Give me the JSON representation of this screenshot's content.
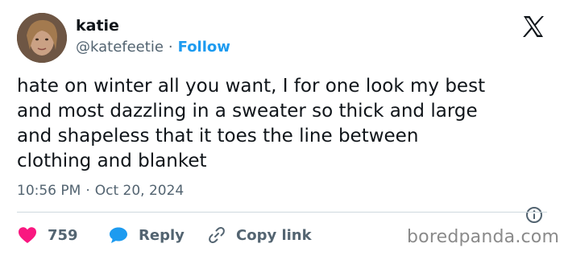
{
  "author": {
    "name": "katie",
    "handle": "@katefeetie",
    "separator": "·",
    "follow_label": "Follow"
  },
  "tweet": {
    "text": "hate on winter all you want, I for one look my best\nand most dazzling in a sweater so thick and large\nand shapeless that it toes the line between\nclothing and blanket",
    "time": "10:56 PM",
    "separator": "·",
    "date": "Oct 20, 2024"
  },
  "actions": {
    "like_count": "759",
    "reply_label": "Reply",
    "copy_label": "Copy link"
  },
  "watermark": "boredpanda.com",
  "colors": {
    "text": "#0f1419",
    "secondary": "#536471",
    "accent": "#1d9bf0",
    "like": "#f91880",
    "divider": "#cfd9de"
  },
  "icons": {
    "logo": "x-logo-icon",
    "info": "info-icon",
    "like": "heart-icon",
    "reply": "speech-bubble-icon",
    "copy": "link-icon"
  }
}
